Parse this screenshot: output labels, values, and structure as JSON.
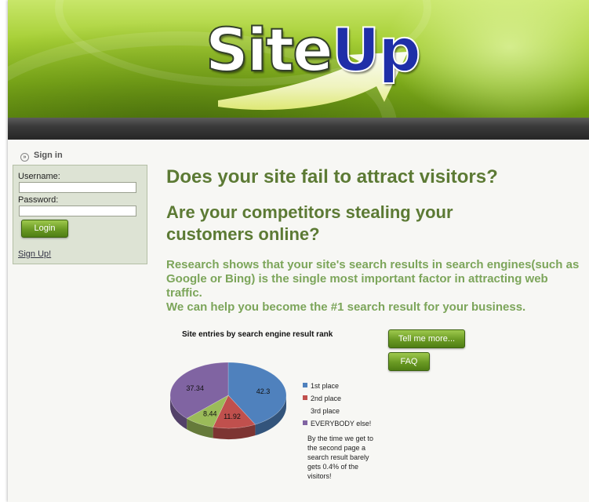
{
  "logo": {
    "site": "Site",
    "up": "Up"
  },
  "signin": {
    "heading": "Sign in",
    "username_label": "Username:",
    "username_value": "",
    "password_label": "Password:",
    "password_value": "",
    "login_button": "Login",
    "signup_link": "Sign Up!"
  },
  "main": {
    "headline1": "Does your site fail to attract visitors?",
    "headline2": "Are your competitors stealing your customers online?",
    "paragraph1": "Research shows that your site's search results in search engines(such as Google or Bing) is the single most important factor in attracting web traffic.",
    "paragraph2": "We can help you become the #1 search result for your business."
  },
  "buttons": {
    "tell_more": "Tell me more...",
    "faq": "FAQ"
  },
  "colors": {
    "brand_green": "#5c7a34",
    "para_green": "#7ca55a",
    "up_blue": "#1f2fa8"
  },
  "chart_data": {
    "type": "pie",
    "title": "Site entries by search engine result rank",
    "series": [
      {
        "name": "1st place",
        "value": 42.3,
        "color": "#4f81bd",
        "label": "42.3"
      },
      {
        "name": "2nd place",
        "value": 11.92,
        "color": "#c0504d",
        "label": "11.92"
      },
      {
        "name": "3rd place",
        "value": 8.44,
        "color": "#9bbb59",
        "label": "8.44"
      },
      {
        "name": "EVERYBODY else!",
        "value": 37.34,
        "color": "#8064a2",
        "label": "37.34"
      }
    ],
    "note": "By the time we get to the second page a search result barely gets 0.4% of the visitors!"
  }
}
